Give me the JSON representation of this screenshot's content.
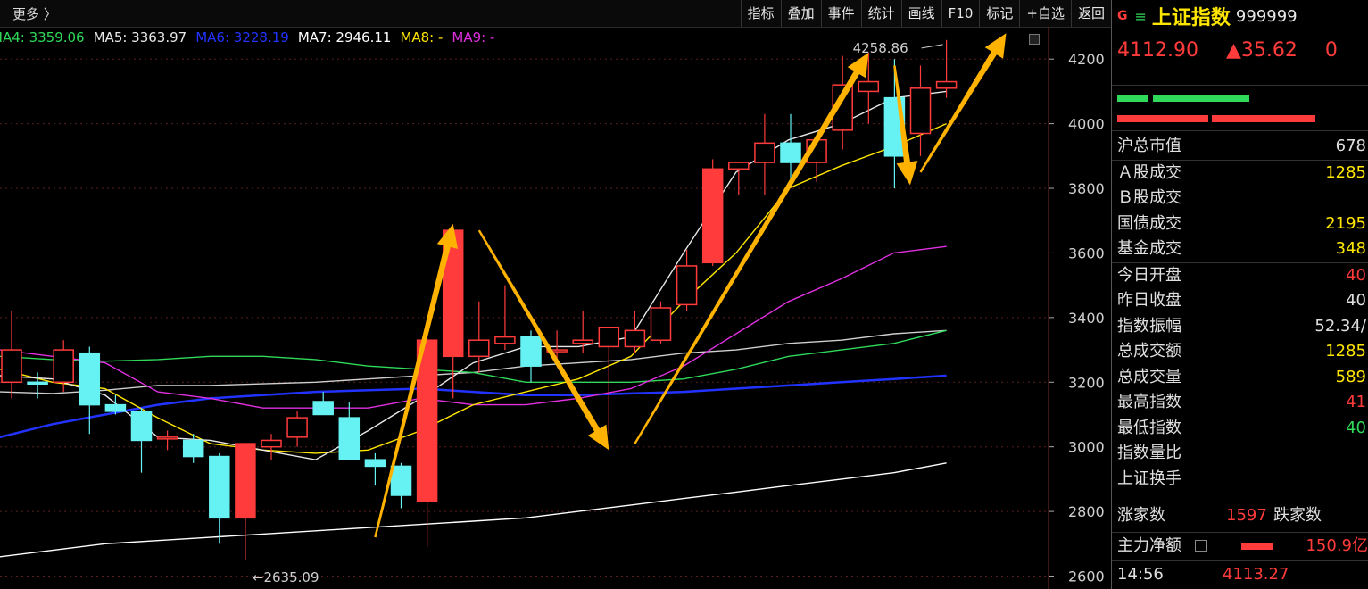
{
  "toolbar": {
    "more_label": "更多 〉",
    "buttons": [
      "指标",
      "叠加",
      "事件",
      "统计",
      "画线",
      "F10",
      "标记",
      "+自选",
      "返回"
    ]
  },
  "ma_legend": [
    {
      "text": "MA4: 3359.06",
      "color": "#2fd95a"
    },
    {
      "text": "MA5: 3363.97",
      "color": "#e8e8e8"
    },
    {
      "text": "MA6: 3228.19",
      "color": "#2233ff"
    },
    {
      "text": "MA7: 2946.11",
      "color": "#ffffff"
    },
    {
      "text": "MA8: -",
      "color": "#ffe600"
    },
    {
      "text": "MA9: -",
      "color": "#e030e0"
    }
  ],
  "chart_data": {
    "type": "candlestick",
    "y_ticks": [
      "4200",
      "4000",
      "3800",
      "3600",
      "3400",
      "3200",
      "3000",
      "2800",
      "2600"
    ],
    "ylim": [
      2560,
      4300
    ],
    "annotations": {
      "high_label": "4258.86",
      "low_label": "←2635.09"
    },
    "candles": [
      {
        "o": 3200,
        "h": 3420,
        "l": 3150,
        "c": 3300
      },
      {
        "o": 3200,
        "h": 3230,
        "l": 3150,
        "c": 3195
      },
      {
        "o": 3200,
        "h": 3330,
        "l": 3170,
        "c": 3300
      },
      {
        "o": 3290,
        "h": 3310,
        "l": 3040,
        "c": 3130
      },
      {
        "o": 3130,
        "h": 3160,
        "l": 3100,
        "c": 3110
      },
      {
        "o": 3110,
        "h": 3120,
        "l": 2920,
        "c": 3020
      },
      {
        "o": 3030,
        "h": 3050,
        "l": 2990,
        "c": 3030
      },
      {
        "o": 3020,
        "h": 3040,
        "l": 2950,
        "c": 2970
      },
      {
        "o": 2970,
        "h": 2980,
        "l": 2700,
        "c": 2780
      },
      {
        "o": 2780,
        "h": 3010,
        "l": 2650,
        "c": 3010
      },
      {
        "o": 3000,
        "h": 3040,
        "l": 2960,
        "c": 3020
      },
      {
        "o": 3030,
        "h": 3110,
        "l": 3000,
        "c": 3090
      },
      {
        "o": 3140,
        "h": 3170,
        "l": 3100,
        "c": 3100
      },
      {
        "o": 3090,
        "h": 3140,
        "l": 2960,
        "c": 2960
      },
      {
        "o": 2960,
        "h": 2980,
        "l": 2880,
        "c": 2940
      },
      {
        "o": 2940,
        "h": 2950,
        "l": 2810,
        "c": 2850
      },
      {
        "o": 2830,
        "h": 3340,
        "l": 2690,
        "c": 3330
      },
      {
        "o": 3280,
        "h": 3680,
        "l": 3150,
        "c": 3670
      },
      {
        "o": 3280,
        "h": 3450,
        "l": 3230,
        "c": 3330
      },
      {
        "o": 3320,
        "h": 3500,
        "l": 3300,
        "c": 3340
      },
      {
        "o": 3340,
        "h": 3360,
        "l": 3200,
        "c": 3250
      },
      {
        "o": 3300,
        "h": 3360,
        "l": 3260,
        "c": 3300
      },
      {
        "o": 3320,
        "h": 3420,
        "l": 3290,
        "c": 3330
      },
      {
        "o": 3310,
        "h": 3350,
        "l": 3040,
        "c": 3370
      },
      {
        "o": 3310,
        "h": 3420,
        "l": 3290,
        "c": 3360
      },
      {
        "o": 3330,
        "h": 3450,
        "l": 3320,
        "c": 3430
      },
      {
        "o": 3440,
        "h": 3610,
        "l": 3420,
        "c": 3560
      },
      {
        "o": 3570,
        "h": 3890,
        "l": 3560,
        "c": 3860
      },
      {
        "o": 3860,
        "h": 3880,
        "l": 3780,
        "c": 3880
      },
      {
        "o": 3880,
        "h": 4030,
        "l": 3780,
        "c": 3940
      },
      {
        "o": 3940,
        "h": 4030,
        "l": 3810,
        "c": 3880
      },
      {
        "o": 3880,
        "h": 3960,
        "l": 3820,
        "c": 3950
      },
      {
        "o": 3980,
        "h": 4210,
        "l": 3920,
        "c": 4120
      },
      {
        "o": 4100,
        "h": 4220,
        "l": 4000,
        "c": 4130
      },
      {
        "o": 4080,
        "h": 4200,
        "l": 3800,
        "c": 3900
      },
      {
        "o": 3970,
        "h": 4180,
        "l": 3900,
        "c": 4110
      },
      {
        "o": 4110,
        "h": 4259,
        "l": 4080,
        "c": 4130
      }
    ],
    "series": [
      {
        "color": "#ffffff",
        "values": [
          2660,
          2680,
          2700,
          2710,
          2720,
          2730,
          2740,
          2750,
          2760,
          2770,
          2780,
          2800,
          2820,
          2840,
          2860,
          2880,
          2900,
          2920,
          2950
        ]
      },
      {
        "color": "#cfcfcf",
        "values": [
          3170,
          3165,
          3175,
          3190,
          3190,
          3195,
          3200,
          3210,
          3220,
          3230,
          3250,
          3260,
          3270,
          3290,
          3300,
          3320,
          3330,
          3350,
          3360
        ]
      },
      {
        "color": "#2fd95a",
        "values": [
          3280,
          3270,
          3265,
          3270,
          3280,
          3280,
          3270,
          3250,
          3240,
          3230,
          3200,
          3200,
          3200,
          3210,
          3240,
          3280,
          3300,
          3320,
          3360
        ]
      },
      {
        "color": "#2233ff",
        "values": [
          3030,
          3070,
          3100,
          3130,
          3150,
          3160,
          3170,
          3175,
          3180,
          3170,
          3160,
          3160,
          3165,
          3170,
          3180,
          3190,
          3200,
          3210,
          3220
        ]
      },
      {
        "color": "#e030e0",
        "values": [
          3300,
          3280,
          3260,
          3170,
          3150,
          3120,
          3120,
          3120,
          3150,
          3130,
          3130,
          3150,
          3180,
          3250,
          3350,
          3450,
          3520,
          3600,
          3620
        ]
      },
      {
        "color": "#ffe600",
        "values": [
          3240,
          3200,
          3180,
          3090,
          3010,
          2990,
          2980,
          2990,
          3050,
          3130,
          3170,
          3210,
          3280,
          3450,
          3600,
          3800,
          3870,
          3930,
          4000
        ]
      },
      {
        "color": "#e8e8e8",
        "values": [
          3220,
          3210,
          3160,
          3030,
          3020,
          2990,
          2960,
          3050,
          3150,
          3260,
          3310,
          3310,
          3340,
          3600,
          3850,
          3950,
          4000,
          4080,
          4100
        ]
      }
    ],
    "arrows": [
      {
        "from": [
          14,
          2720
        ],
        "to": [
          17,
          3690
        ]
      },
      {
        "from": [
          18,
          3670
        ],
        "to": [
          23,
          2990
        ]
      },
      {
        "from": [
          24,
          3010
        ],
        "to": [
          33,
          4220
        ]
      },
      {
        "from": [
          34,
          4180
        ],
        "to": [
          34.6,
          3810
        ]
      },
      {
        "from": [
          35,
          3850
        ],
        "to": [
          38.3,
          4280
        ]
      }
    ]
  },
  "panel": {
    "g_mark": "G",
    "eq_mark": "≡",
    "name": "上证指数",
    "code": "999999",
    "price": "4112.90",
    "change": "▲35.62",
    "change_pct": "0",
    "rows": [
      {
        "label": "沪总市值",
        "value": "678",
        "color": "#e0e0e0"
      },
      {
        "label": "Ａ股成交",
        "value": "1285",
        "color": "#ffe600"
      },
      {
        "label": "Ｂ股成交",
        "value": "",
        "color": "#ffe600"
      },
      {
        "label": "国债成交",
        "value": "2195",
        "color": "#ffe600"
      },
      {
        "label": "基金成交",
        "value": "348",
        "color": "#ffe600"
      },
      {
        "label": "今日开盘",
        "value": "40",
        "color": "#ff3b3b"
      },
      {
        "label": "昨日收盘",
        "value": "40",
        "color": "#e0e0e0"
      },
      {
        "label": "指数振幅",
        "value": "52.34/",
        "color": "#e0e0e0"
      },
      {
        "label": "总成交额",
        "value": "1285",
        "color": "#ffe600"
      },
      {
        "label": "总成交量",
        "value": "589",
        "color": "#ffe600"
      },
      {
        "label": "最高指数",
        "value": "41",
        "color": "#ff3b3b"
      },
      {
        "label": "最低指数",
        "value": "40",
        "color": "#2fd95a"
      },
      {
        "label": "指数量比",
        "value": "",
        "color": "#e0e0e0"
      },
      {
        "label": "上证换手",
        "value": "",
        "color": "#e0e0e0"
      }
    ],
    "up_label": "涨家数",
    "up_value": "1597",
    "down_label": "跌家数",
    "main_label": "主力净额",
    "main_value": "150.9亿",
    "time": "14:56",
    "time_price": "4113.27"
  },
  "colors": {
    "up": "#ff3b3b",
    "down": "#66f2f2",
    "grid": "#5a1f1f",
    "axis": "#aaaaaa",
    "arrow": "#ffb300"
  }
}
